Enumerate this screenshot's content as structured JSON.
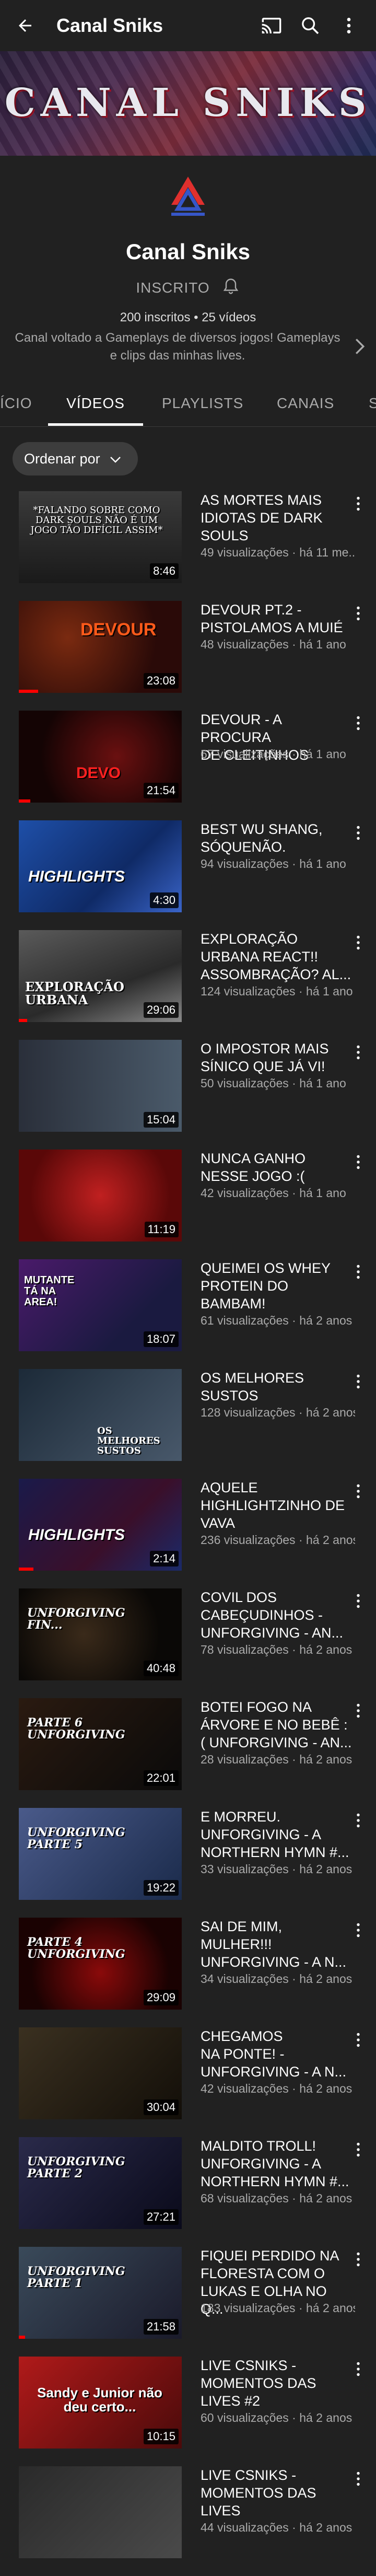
{
  "header": {
    "title": "Canal Sniks"
  },
  "banner": {
    "text": "CANAL SNIKS"
  },
  "channel": {
    "name": "Canal Sniks",
    "subscribe_label": "INSCRITO",
    "stats": "200 inscritos • 25 vídeos",
    "description_line1": "Canal voltado a Gameplays de diversos jogos! Gameplays",
    "description_line2": "e clips das minhas lives."
  },
  "tabs": [
    "ÍCIO",
    "VÍDEOS",
    "PLAYLISTS",
    "CANAIS",
    "S"
  ],
  "sort": {
    "label": "Ordenar por"
  },
  "videos": [
    {
      "title_l1": "AS MORTES MAIS",
      "title_l2": "IDIOTAS DE DARK",
      "title_l3": "SOULS",
      "meta": "49 visualizações · há 11 me...",
      "duration": "8:46",
      "thumb_text": "*FALANDO SOBRE COMO DARK SOULS NÃO É UM JOGO TÃO DIFÍCIL ASSIM*",
      "progress": 0.0
    },
    {
      "title_l1": "DEVOUR PT.2 -",
      "title_l2": "PISTOLAMOS A MUIÉ",
      "title_l3": "",
      "meta": "48 visualizações · há 1 ano",
      "duration": "23:08",
      "thumb_text": "DEVOUR",
      "progress": 0.12
    },
    {
      "title_l1": "DEVOUR - A PROCURA",
      "title_l2": "DE CLEITINHOS",
      "title_l3": "",
      "meta": "67 visualizações · há 1 ano",
      "duration": "21:54",
      "thumb_text": "DEVO",
      "progress": 0.07
    },
    {
      "title_l1": "BEST WU SHANG,",
      "title_l2": "SÓQUENÃO.",
      "title_l3": "",
      "meta": "94 visualizações · há 1 ano",
      "duration": "4:30",
      "thumb_text": "HIGHLIGHTS",
      "progress": 0.0
    },
    {
      "title_l1": "EXPLORAÇÃO",
      "title_l2": "URBANA REACT!!",
      "title_l3": "ASSOMBRAÇÃO? AL...",
      "meta": "124 visualizações · há 1 ano",
      "duration": "29:06",
      "thumb_text": "EXPLORAÇÃO URBANA",
      "progress": 0.05
    },
    {
      "title_l1": "O IMPOSTOR MAIS",
      "title_l2": "SÍNICO QUE JÁ VI!",
      "title_l3": "",
      "meta": "50 visualizações · há 1 ano",
      "duration": "15:04",
      "thumb_text": "",
      "progress": 0.0
    },
    {
      "title_l1": "NUNCA GANHO",
      "title_l2": "NESSE JOGO :(",
      "title_l3": "",
      "meta": "42 visualizações · há 1 ano",
      "duration": "11:19",
      "thumb_text": "",
      "progress": 0.0
    },
    {
      "title_l1": "QUEIMEI OS WHEY",
      "title_l2": "PROTEIN DO",
      "title_l3": "BAMBAM!",
      "meta": "61 visualizações · há 2 anos",
      "duration": "18:07",
      "thumb_text": "MUTANTE TÁ NA AREA!",
      "progress": 0.0
    },
    {
      "title_l1": "OS MELHORES",
      "title_l2": "SUSTOS",
      "title_l3": "",
      "meta": "128 visualizações · há 2 anos",
      "duration": "",
      "thumb_text": "OS MELHORES SUSTOS",
      "progress": 0.0
    },
    {
      "title_l1": "AQUELE",
      "title_l2": "HIGHLIGHTZINHO DE",
      "title_l3": "VAVA",
      "meta": "236 visualizações · há 2 anos",
      "duration": "2:14",
      "thumb_text": "HIGHLIGHTS",
      "progress": 0.09
    },
    {
      "title_l1": "COVIL DOS",
      "title_l2": "CABEÇUDINHOS -",
      "title_l3": "UNFORGIVING - AN...",
      "meta": "78 visualizações · há 2 anos",
      "duration": "40:48",
      "thumb_text": "UNFORGIVING FIN...",
      "progress": 0.0
    },
    {
      "title_l1": "BOTEI FOGO NA",
      "title_l2": "ÁRVORE E NO BEBÊ :",
      "title_l3": "( UNFORGIVING - AN...",
      "meta": "28 visualizações · há 2 anos",
      "duration": "22:01",
      "thumb_text": "PARTE 6 UNFORGIVING",
      "progress": 0.0
    },
    {
      "title_l1": "E MORREU.",
      "title_l2": "UNFORGIVING - A",
      "title_l3": "NORTHERN HYMN #...",
      "meta": "33 visualizações · há 2 anos",
      "duration": "19:22",
      "thumb_text": "UNFORGIVING PARTE 5",
      "progress": 0.0
    },
    {
      "title_l1": "SAI DE MIM,",
      "title_l2": "MULHER!!!",
      "title_l3": "UNFORGIVING - A N...",
      "meta": "34 visualizações · há 2 anos",
      "duration": "29:09",
      "thumb_text": "PARTE 4 UNFORGIVING",
      "progress": 0.0
    },
    {
      "title_l1": "CHEGAMOS",
      "title_l2": "NA PONTE! -",
      "title_l3": "UNFORGIVING - A N...",
      "meta": "42 visualizações · há 2 anos",
      "duration": "30:04",
      "thumb_text": "",
      "progress": 0.0
    },
    {
      "title_l1": "MALDITO TROLL!",
      "title_l2": "UNFORGIVING - A",
      "title_l3": "NORTHERN HYMN #...",
      "meta": "68 visualizações · há 2 anos",
      "duration": "27:21",
      "thumb_text": "UNFORGIVING PARTE 2",
      "progress": 0.0
    },
    {
      "title_l1": "FIQUEI PERDIDO NA",
      "title_l2": "FLORESTA COM O",
      "title_l3": "LUKAS E OLHA NO Q...",
      "meta": "183 visualizações · há 2 anos",
      "duration": "21:58",
      "thumb_text": "UNFORGIVING PARTE 1",
      "progress": 0.04
    },
    {
      "title_l1": "LIVE CSNIKS -",
      "title_l2": "MOMENTOS DAS",
      "title_l3": "LIVES #2",
      "meta": "60 visualizações · há 2 anos",
      "duration": "10:15",
      "thumb_text": "Sandy e Junior não deu certo...",
      "progress": 0.0
    },
    {
      "title_l1": "LIVE CSNIKS -",
      "title_l2": "MOMENTOS DAS",
      "title_l3": "LIVES",
      "meta": "44 visualizações · há 2 anos",
      "duration": "",
      "thumb_text": "",
      "progress": 0.0
    }
  ],
  "colors": {
    "background": "#212121",
    "accent": "#ff0000",
    "secondary_text": "#aaaaaa"
  }
}
